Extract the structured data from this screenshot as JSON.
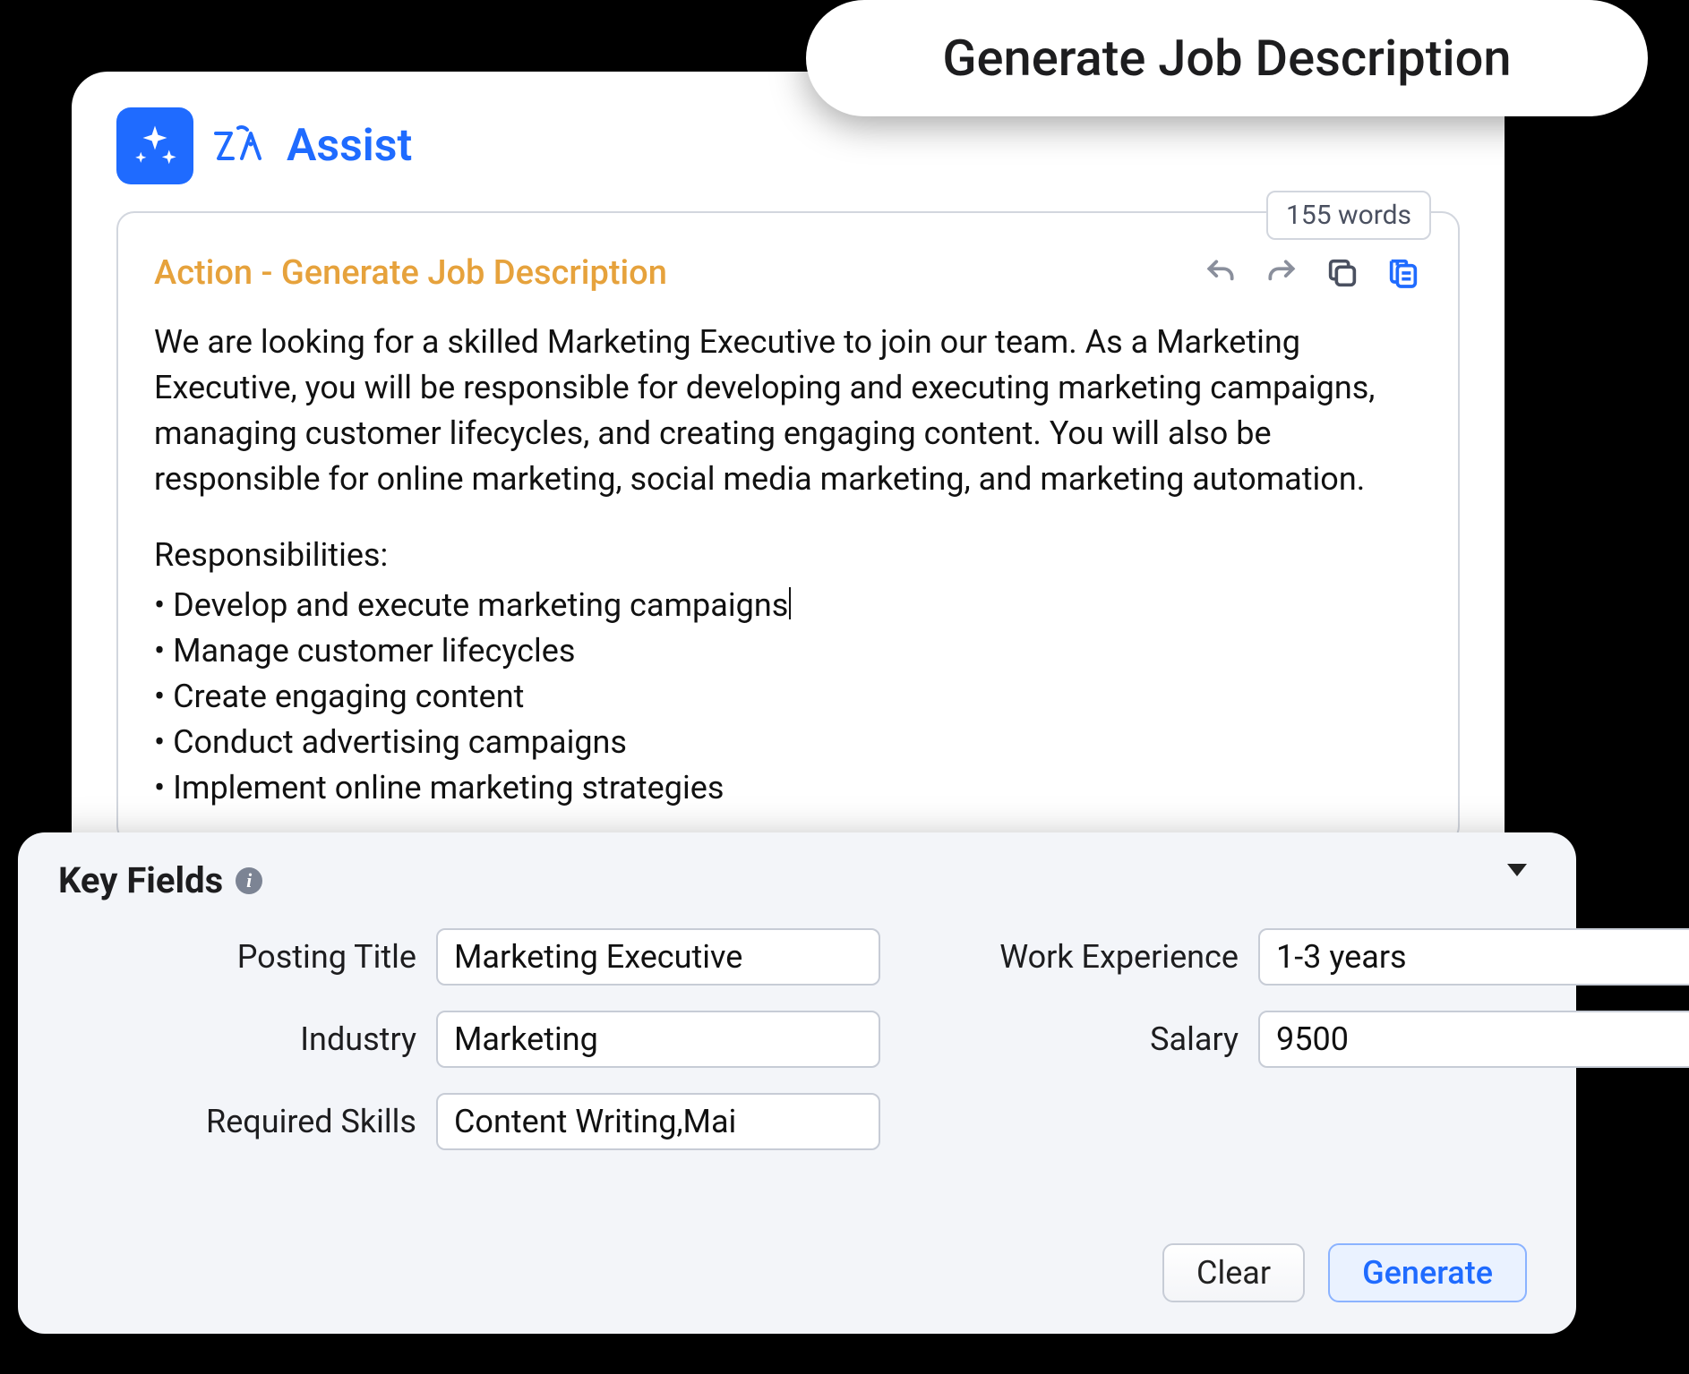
{
  "pill": {
    "title": "Generate Job Description"
  },
  "assist": {
    "brand": "Assist",
    "word_count": "155 words",
    "action_label": "Action - Generate Job Description",
    "body_paragraph": "We are looking for a skilled Marketing Executive to join our team. As a Marketing Executive, you will be responsible for developing and executing marketing campaigns, managing customer lifecycles, and creating engaging content. You will also be responsible for online marketing, social media marketing, and marketing automation.",
    "responsibilities_title": "Responsibilities:",
    "bullets": [
      "• Develop and execute marketing campaigns",
      "• Manage customer lifecycles",
      "• Create engaging content",
      "• Conduct advertising campaigns",
      "• Implement online marketing strategies"
    ]
  },
  "key_fields": {
    "title": "Key Fields",
    "labels": {
      "posting_title": "Posting Title",
      "work_experience": "Work Experience",
      "industry": "Industry",
      "salary": "Salary",
      "required_skills": "Required Skills"
    },
    "values": {
      "posting_title": "Marketing Executive",
      "work_experience": "1-3 years",
      "industry": "Marketing",
      "salary": "9500",
      "required_skills": "Content Writing,Mai"
    },
    "buttons": {
      "clear": "Clear",
      "generate": "Generate"
    }
  },
  "icons": {
    "undo": "undo-icon",
    "redo": "redo-icon",
    "copy": "copy-icon",
    "doc": "doc-copy-icon"
  }
}
